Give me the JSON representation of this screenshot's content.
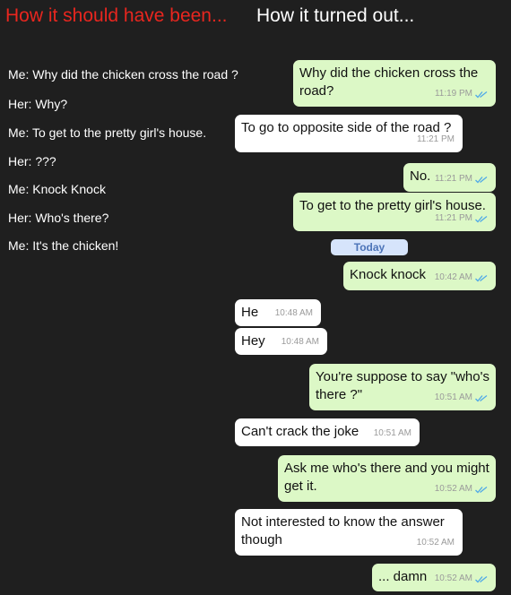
{
  "titles": {
    "left": "How it should have been...",
    "right": "How it turned out..."
  },
  "script_lines": [
    "Me: Why did the chicken cross the road ?",
    "Her: Why?",
    "Me: To get to the pretty girl's house.",
    "Her: ???",
    "Me: Knock Knock",
    "Her: Who's there?",
    "Me: It's the chicken!"
  ],
  "day_divider": "Today",
  "messages": [
    {
      "text": "Why did the chicken cross the road?",
      "time": "11:19 PM",
      "dir": "out"
    },
    {
      "text": "To go to opposite side of the road ?",
      "time": "11:21 PM",
      "dir": "in"
    },
    {
      "text": "No.",
      "time": "11:21 PM",
      "dir": "out"
    },
    {
      "text": "To get to the pretty girl's house.",
      "time": "11:21 PM",
      "dir": "out"
    },
    {
      "text": "Knock knock",
      "time": "10:42 AM",
      "dir": "out"
    },
    {
      "text": "He",
      "time": "10:48 AM",
      "dir": "in"
    },
    {
      "text": "Hey",
      "time": "10:48 AM",
      "dir": "in"
    },
    {
      "text": "You're suppose to say \"who's there ?\"",
      "time": "10:51 AM",
      "dir": "out"
    },
    {
      "text": "Can't crack the joke",
      "time": "10:51 AM",
      "dir": "in"
    },
    {
      "text": "Ask me who's there and you might get it.",
      "time": "10:52 AM",
      "dir": "out"
    },
    {
      "text": "Not interested to know the answer though",
      "time": "10:52 AM",
      "dir": "in"
    },
    {
      "text": "... damn",
      "time": "10:52 AM",
      "dir": "out"
    }
  ],
  "colors": {
    "background": "#1f1f1f",
    "title_left": "#e8261f",
    "outgoing_bubble": "#dcf8c6",
    "incoming_bubble": "#ffffff",
    "read_ticks": "#4fa9e8"
  },
  "icons": {
    "read_receipt": "double-check-icon"
  }
}
